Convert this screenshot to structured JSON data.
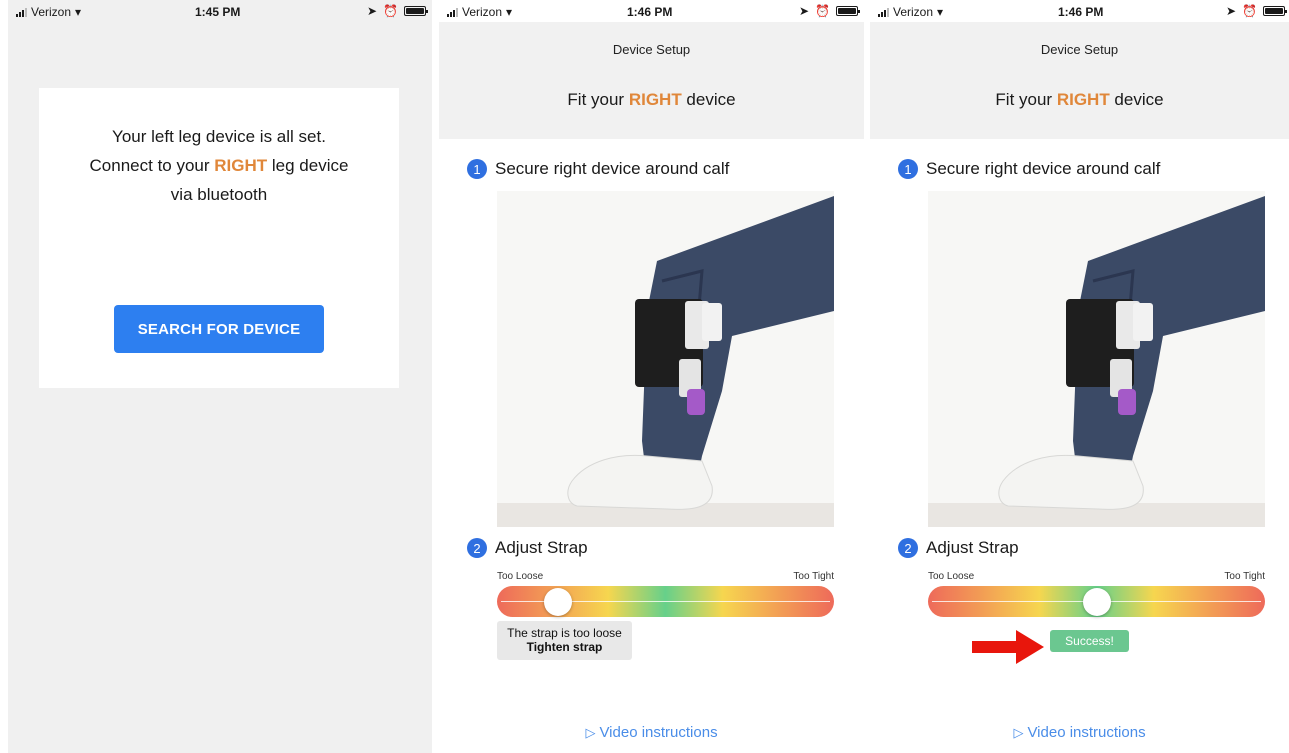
{
  "status": {
    "p1": {
      "carrier": "Verizon",
      "time": "1:45 PM"
    },
    "p2": {
      "carrier": "Verizon",
      "time": "1:46 PM"
    },
    "p3": {
      "carrier": "Verizon",
      "time": "1:46 PM"
    }
  },
  "connect_screen": {
    "line1": "Your left leg device is all set.",
    "line2_pre": "Connect to your ",
    "line2_highlight": "RIGHT",
    "line2_post": " leg device",
    "line3": "via bluetooth",
    "button_label": "SEARCH FOR DEVICE"
  },
  "setup_screen": {
    "header_title": "Device Setup",
    "fit_pre": "Fit your ",
    "fit_highlight": "RIGHT",
    "fit_post": " device",
    "step1_number": "1",
    "step1_label": "Secure right device around calf",
    "step2_number": "2",
    "step2_label": "Adjust Strap",
    "scale_left": "Too Loose",
    "scale_right": "Too Tight",
    "video_label": "Video instructions"
  },
  "strap_states": {
    "p2": {
      "level": 0.18,
      "tip_line1": "The strap is too loose",
      "tip_line2": "Tighten strap"
    },
    "p3": {
      "level": 0.5,
      "success_label": "Success!"
    }
  },
  "colors": {
    "accent": "#2d7ff0",
    "highlight": "#e0873a",
    "success": "#6bc790",
    "arrow": "#e8160c"
  },
  "icons": [
    "signal-icon",
    "wifi-icon",
    "location-icon",
    "alarm-icon",
    "battery-icon",
    "play-icon",
    "red-arrow-icon"
  ]
}
